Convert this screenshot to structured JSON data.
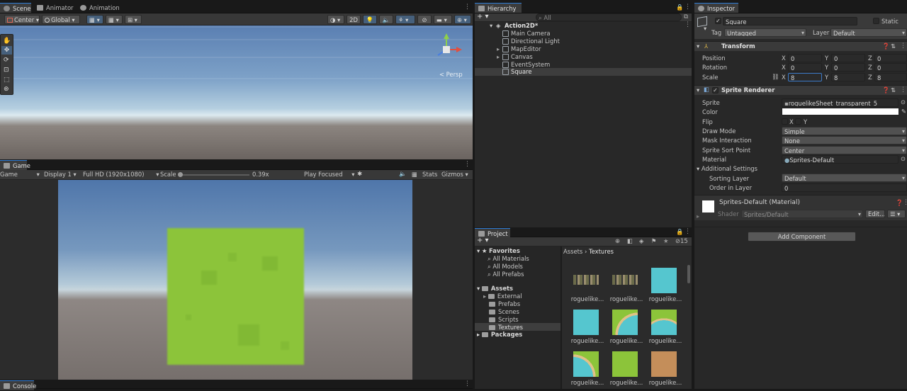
{
  "scene": {
    "tab_scene": "Scene",
    "tab_animator": "Animator",
    "tab_animation": "Animation",
    "pivot_mode": "Center",
    "pivot_rotation": "Global",
    "btn_2d": "2D",
    "persp_label": "< Persp"
  },
  "game": {
    "tab_game": "Game",
    "mode": "Game",
    "display": "Display 1",
    "resolution": "Full HD (1920x1080)",
    "scale_label": "Scale",
    "scale_value": "0.39x",
    "play_focused": "Play Focused",
    "stats": "Stats",
    "gizmos": "Gizmos",
    "object_color": "#8cc43a"
  },
  "console": {
    "tab": "Console"
  },
  "hierarchy": {
    "tab": "Hierarchy",
    "search_placeholder": "All",
    "scene_name": "Action2D*",
    "items": [
      {
        "label": "Main Camera"
      },
      {
        "label": "Directional Light"
      },
      {
        "label": "MapEditor"
      },
      {
        "label": "Canvas"
      },
      {
        "label": "EventSystem"
      },
      {
        "label": "Square"
      }
    ]
  },
  "project": {
    "tab": "Project",
    "badge_count": "15",
    "favorites": "Favorites",
    "fav_items": [
      "All Materials",
      "All Models",
      "All Prefabs"
    ],
    "assets": "Assets",
    "asset_folders": [
      "External",
      "Prefabs",
      "Scenes",
      "Scripts",
      "Textures"
    ],
    "packages": "Packages",
    "breadcrumb_root": "Assets",
    "breadcrumb_current": "Textures",
    "thumb_label": "roguelike...",
    "thumb_kinds": [
      "sheet",
      "sheet",
      "water",
      "water",
      "shore_corner",
      "shore_top",
      "shore_corner2",
      "grass",
      "dirt"
    ]
  },
  "inspector": {
    "tab": "Inspector",
    "object_name": "Square",
    "static_label": "Static",
    "tag_label": "Tag",
    "tag_value": "Untagged",
    "layer_label": "Layer",
    "layer_value": "Default",
    "transform": {
      "title": "Transform",
      "position_label": "Position",
      "rotation_label": "Rotation",
      "scale_label": "Scale",
      "position": [
        "0",
        "0",
        "0"
      ],
      "rotation": [
        "0",
        "0",
        "0"
      ],
      "scale": [
        "8",
        "8",
        "8"
      ]
    },
    "sprite_renderer": {
      "title": "Sprite Renderer",
      "sprite_label": "Sprite",
      "sprite_value": "roguelikeSheet_transparent_5",
      "color_label": "Color",
      "color_value": "#ffffff",
      "flip_label": "Flip",
      "flip_x": "X",
      "flip_y": "Y",
      "draw_mode_label": "Draw Mode",
      "draw_mode_value": "Simple",
      "mask_label": "Mask Interaction",
      "mask_value": "None",
      "sort_point_label": "Sprite Sort Point",
      "sort_point_value": "Center",
      "material_label": "Material",
      "material_value": "Sprites-Default",
      "additional_label": "Additional Settings",
      "sorting_layer_label": "Sorting Layer",
      "sorting_layer_value": "Default",
      "order_label": "Order in Layer",
      "order_value": "0"
    },
    "material": {
      "name": "Sprites-Default (Material)",
      "shader_label": "Shader",
      "shader_value": "Sprites/Default",
      "edit_label": "Edit..."
    },
    "add_component": "Add Component"
  }
}
